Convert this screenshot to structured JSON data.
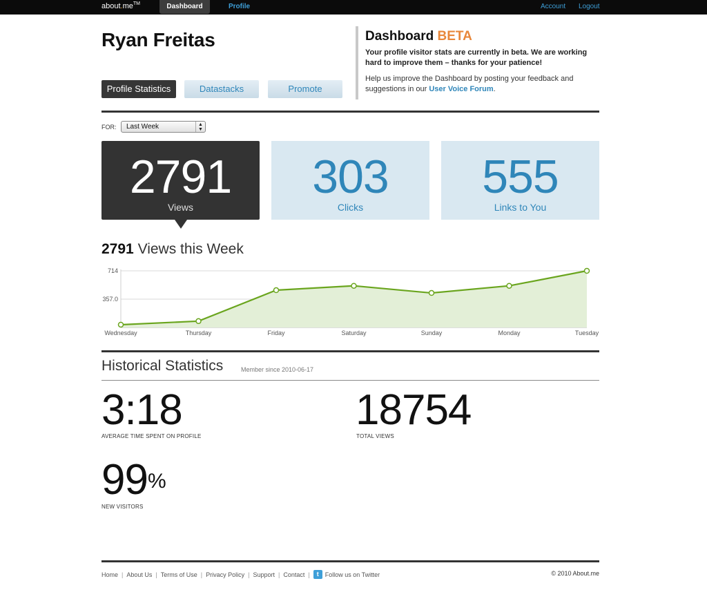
{
  "topbar": {
    "logo_text": "about",
    "logo_dot": ".",
    "logo_me": "me",
    "logo_tm": "TM",
    "nav_dashboard": "Dashboard",
    "nav_profile": "Profile",
    "account": "Account",
    "logout": "Logout"
  },
  "header": {
    "name": "Ryan Freitas",
    "tabs": [
      "Profile Statistics",
      "Datastacks",
      "Promote"
    ]
  },
  "beta": {
    "title": "Dashboard",
    "badge": "BETA",
    "para1": "Your profile visitor stats are currently in beta. We are working hard to improve them – thanks for your patience!",
    "para2_pre": "Help us improve the Dashboard by posting your feedback and suggestions in our",
    "para2_link": "User Voice Forum",
    "para2_post": ".",
    "accent_color": "#e8873a"
  },
  "period": {
    "label": "FOR:",
    "selected": "Last Week"
  },
  "stats": [
    {
      "value": "2791",
      "label": "Views"
    },
    {
      "value": "303",
      "label": "Clicks"
    },
    {
      "value": "555",
      "label": "Links to You"
    }
  ],
  "week": {
    "count": "2791",
    "label": "Views this Week"
  },
  "chart_data": {
    "type": "area",
    "categories": [
      "Wednesday",
      "Thursday",
      "Friday",
      "Saturday",
      "Sunday",
      "Monday",
      "Tuesday"
    ],
    "values": [
      35,
      80,
      470,
      525,
      435,
      525,
      714
    ],
    "y_ticks": [
      "714",
      "357.0"
    ],
    "ylim": [
      0,
      714
    ],
    "grid": true,
    "line_color": "#6aa51e",
    "fill_color": "#e3efd7"
  },
  "historical": {
    "title": "Historical Statistics",
    "member_since": "Member since 2010-06-17",
    "avg_time": "3:18",
    "avg_time_label": "AVERAGE TIME SPENT ON PROFILE",
    "total_views": "18754",
    "total_views_label": "TOTAL VIEWS",
    "new_visitors": "99",
    "new_visitors_unit": "%",
    "new_visitors_label": "NEW VISITORS"
  },
  "footer": {
    "links": [
      "Home",
      "About Us",
      "Terms of Use",
      "Privacy Policy",
      "Support",
      "Contact"
    ],
    "twitter": "Follow us on Twitter",
    "copyright": "© 2010 About.me"
  }
}
